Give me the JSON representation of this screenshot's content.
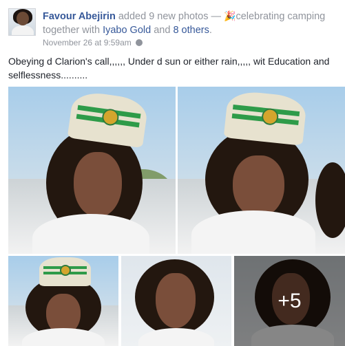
{
  "post": {
    "author": "Favour Abejirin",
    "action": "added 9 new photos —",
    "activity_icon": "party-popper-icon",
    "activity": "celebrating camping",
    "together_with": "together with",
    "tagged_friend": "Iyabo Gold",
    "and_word": "and",
    "others": "8 others",
    "period": ".",
    "timestamp": "November 26 at 9:59am",
    "privacy_icon": "globe-icon",
    "text": "Obeying d Clarion's call,,,,,, Under d sun or either rain,,,,, wit Education and selflessness.........."
  },
  "photos": {
    "more_count": "+5"
  },
  "colors": {
    "link": "#365899",
    "meta": "#90949c",
    "text": "#1d2129"
  }
}
